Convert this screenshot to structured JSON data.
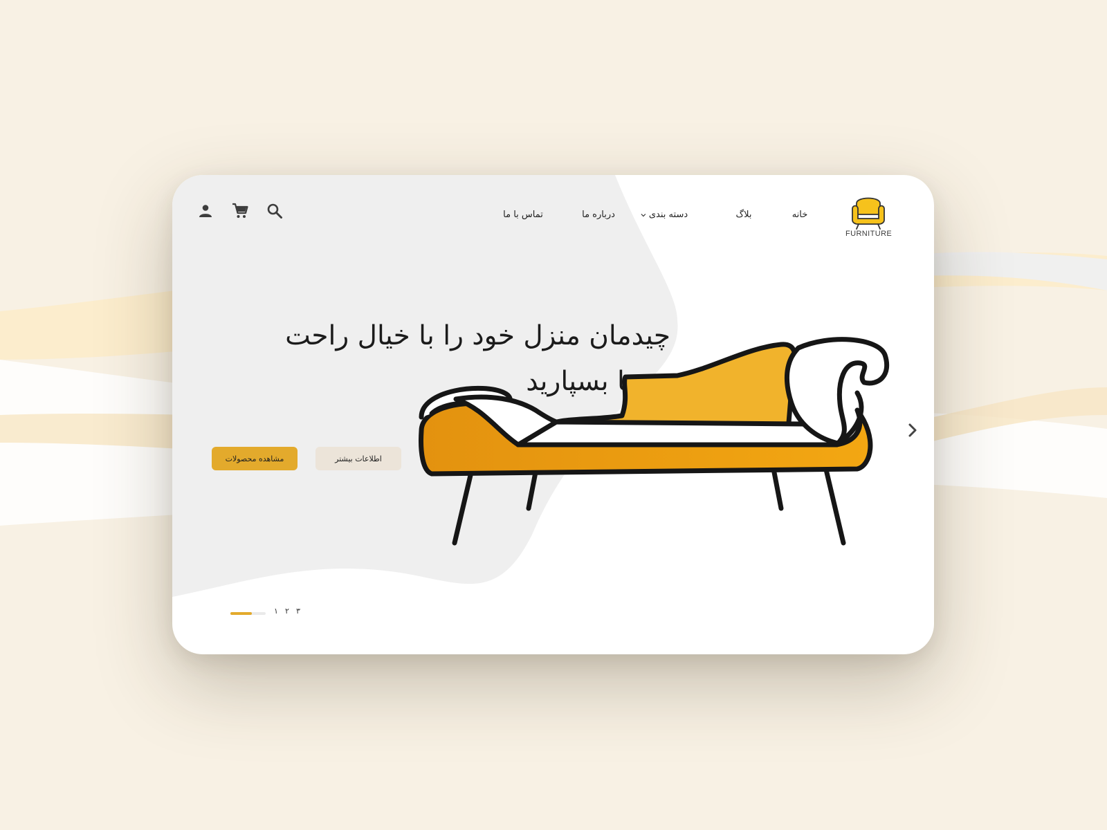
{
  "brand": {
    "logo_text": "FURNITURE",
    "accent_color": "#e3aa2c",
    "sofa_colors": [
      "#f0b02c",
      "#e4950f"
    ]
  },
  "nav": {
    "items": [
      {
        "label": "خانه"
      },
      {
        "label": "بلاگ"
      },
      {
        "label": "دسته بندی",
        "has_dropdown": true
      },
      {
        "label": "درباره ما"
      },
      {
        "label": "تماس با ما"
      }
    ]
  },
  "header_icons": [
    "search-icon",
    "cart-icon",
    "user-icon"
  ],
  "hero": {
    "headline_line1": "چیدمان منزل خود را با خیال راحت",
    "headline_line2": "به ما بسپارید",
    "primary_button": "مشاهده محصولات",
    "secondary_button": "اطلاعات بیشتر"
  },
  "slider": {
    "pages": [
      "۱",
      "۲",
      "۳"
    ],
    "current_page": 1,
    "progress": 0.6
  }
}
